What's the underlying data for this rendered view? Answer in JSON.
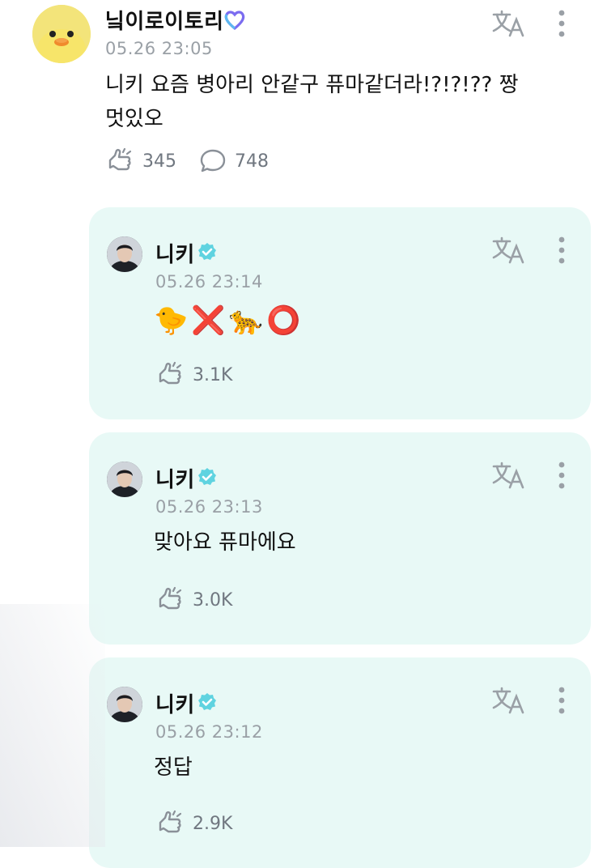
{
  "post": {
    "author": "닠이로이토리",
    "timestamp": "05.26 23:05",
    "text_line1": "니키 요즘 병아리 안같구 퓨마같더라!?!?!?? 짱",
    "text_line2": "멋있오",
    "likes": "345",
    "comments": "748"
  },
  "replies": [
    {
      "author": "니키",
      "timestamp": "05.26 23:14",
      "emojis": [
        "🐤",
        "❌",
        "🐆",
        "⭕"
      ],
      "text": "",
      "likes": "3.1K"
    },
    {
      "author": "니키",
      "timestamp": "05.26 23:13",
      "text": "맞아요 퓨마에요",
      "likes": "3.0K"
    },
    {
      "author": "니키",
      "timestamp": "05.26 23:12",
      "text": "정답",
      "likes": "2.9K"
    }
  ],
  "colors": {
    "card_bg": "#e8f9f6",
    "verified": "#5fd3e0",
    "muted_text": "#9aa0a6",
    "heart_badge": "#7b6cf0"
  },
  "icons": {
    "translate": "translate-icon",
    "more": "more-vertical-icon",
    "like": "like-hand-icon",
    "comment": "comment-bubble-icon",
    "verified": "verified-check-icon"
  }
}
